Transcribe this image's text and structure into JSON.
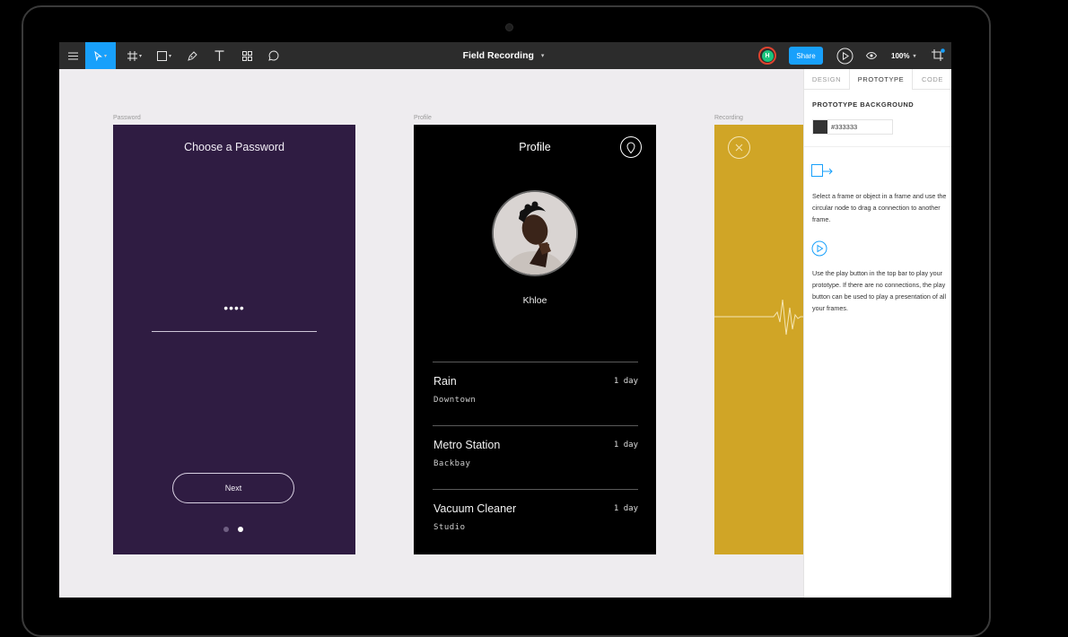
{
  "toolbar": {
    "file_title": "Field Recording",
    "zoom": "100%",
    "share_label": "Share",
    "avatar_initial": "H",
    "tools": [
      "menu-icon",
      "move-tool-icon",
      "frame-tool-icon",
      "shape-tool-icon",
      "pen-tool-icon",
      "text-tool-icon",
      "components-icon",
      "comment-icon"
    ],
    "right_icons": [
      "play-icon",
      "eye-icon",
      "crop-icon"
    ]
  },
  "canvas": {
    "frames": [
      {
        "label": "Password"
      },
      {
        "label": "Profile"
      },
      {
        "label": "Recording"
      }
    ],
    "password_screen": {
      "title": "Choose a Password",
      "masked_value": "••••",
      "next_label": "Next",
      "pager": {
        "count": 2,
        "active_index": 1
      }
    },
    "profile_screen": {
      "title": "Profile",
      "name": "Khloe",
      "recordings": [
        {
          "name": "Rain",
          "location": "Downtown",
          "time": "1 day"
        },
        {
          "name": "Metro Station",
          "location": "Backbay",
          "time": "1 day"
        },
        {
          "name": "Vacuum Cleaner",
          "location": "Studio",
          "time": "1 day"
        }
      ]
    }
  },
  "panel": {
    "tabs": [
      "DESIGN",
      "PROTOTYPE",
      "CODE"
    ],
    "active_tab": "PROTOTYPE",
    "section_title": "PROTOTYPE BACKGROUND",
    "bg_hex": "#333333",
    "help1": "Select a frame or object in a frame and use the circular node to drag a connection to another frame.",
    "help2": "Use the play button in the top bar to play your prototype. If there are no connections, the play button can be used to play a presentation of all your frames."
  },
  "colors": {
    "accent": "#18a0fb",
    "password_bg": "#2f1c42",
    "profile_bg": "#000000",
    "recording_bg": "#d0a526",
    "avatar_green": "#1bc47d",
    "avatar_ring": "#e0432f"
  }
}
